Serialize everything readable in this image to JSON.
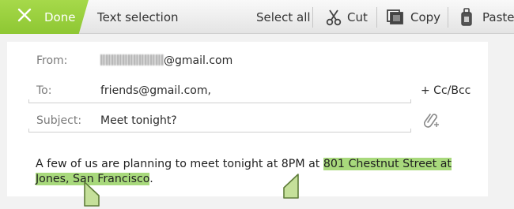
{
  "action_bar": {
    "done_label": "Done",
    "mode_title": "Text selection",
    "select_all_label": "Select all",
    "cut_label": "Cut",
    "copy_label": "Copy",
    "paste_label": "Paste",
    "accent_color": "#9acd3f"
  },
  "compose": {
    "from_label": "From:",
    "from_value_suffix": "@gmail.com",
    "to_label": "To:",
    "to_value": "friends@gmail.com,",
    "cc_bcc_label": "+ Cc/Bcc",
    "subject_label": "Subject:",
    "subject_value": "Meet tonight?",
    "attach_icon": "attachment-add-icon",
    "body_before": "A few of us are planning to meet tonight at 8PM at ",
    "body_selected": "801 Chestnut Street at Jones, San Francisco",
    "body_after": ".",
    "selection_color": "#a8d97c"
  }
}
